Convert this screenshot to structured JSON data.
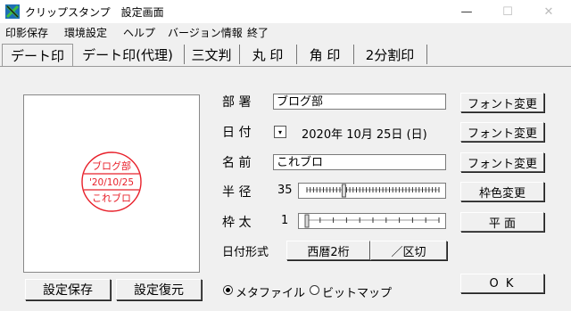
{
  "window": {
    "title": "クリップスタンプ　設定画面",
    "minimize": "—",
    "maximize": "☐",
    "close": "✕"
  },
  "menu": [
    "印影保存",
    "環境設定",
    "ヘルプ",
    "バージョン情報",
    "終了"
  ],
  "tabs": [
    "デート印",
    "デート印(代理)",
    "三文判",
    "丸 印",
    "角 印",
    "2分割印"
  ],
  "active_tab": "デート印",
  "stamp": {
    "top": "ブログ部",
    "middle": "'20/10/25",
    "bottom": "これブロ",
    "color": "#e8202a"
  },
  "form": {
    "dept_label": "部 署",
    "dept_value": "ブログ部",
    "date_label": "日 付",
    "date_value": "2020年 10月 25日 (日)",
    "name_label": "名 前",
    "name_value": "これブロ",
    "radius_label": "半 径",
    "radius_value": "35",
    "frame_label": "枠 太",
    "frame_value": "1",
    "datefmt_label": "日付形式",
    "datefmt_left": "西暦2桁",
    "datefmt_right": "／区切"
  },
  "buttons": {
    "font1": "フォント変更",
    "font2": "フォント変更",
    "font3": "フォント変更",
    "framecolor": "枠色変更",
    "flat": "平 面",
    "save": "設定保存",
    "restore": "設定復元",
    "ok": "O K"
  },
  "radio": {
    "meta": "メタファイル",
    "bitmap": "ビットマップ",
    "selected": "meta"
  }
}
